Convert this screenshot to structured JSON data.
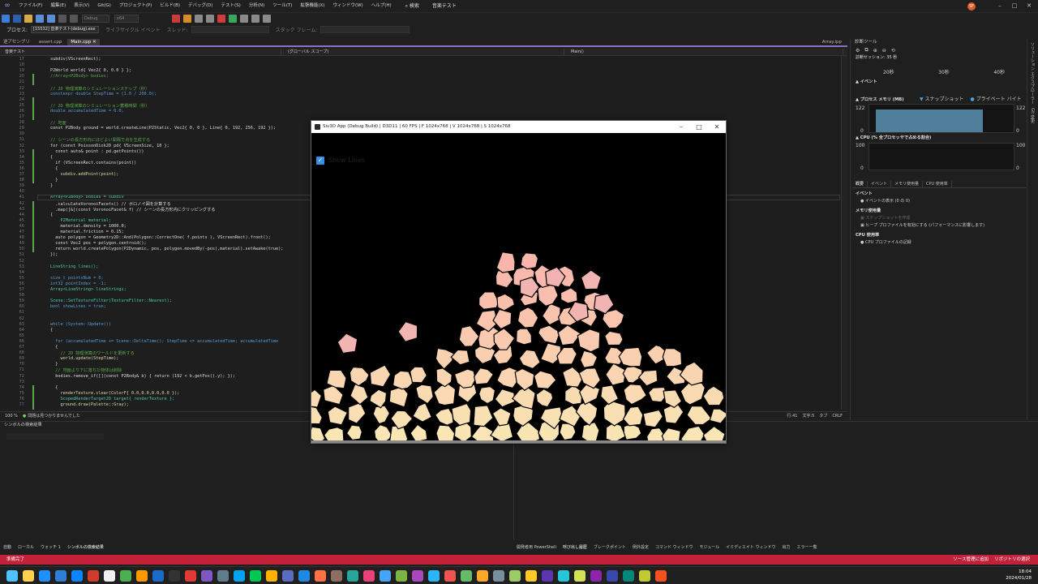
{
  "menubar": {
    "items": [
      "ファイル(F)",
      "編集(E)",
      "表示(V)",
      "Git(G)",
      "プロジェクト(P)",
      "ビルド(B)",
      "デバッグ(D)",
      "テスト(S)",
      "分析(N)",
      "ツール(T)",
      "拡張機能(X)",
      "ウィンドウ(W)",
      "ヘルプ(H)"
    ],
    "search_label": "検索",
    "solution_title": "音楽テスト",
    "avatar_initials": "SF"
  },
  "toolbar": {
    "config": "Debug",
    "platform": "x64",
    "process_label": "プロセス:",
    "process_value": "[15532] 音楽テスト(debug).exe",
    "lifecycle_label": "ライフサイクル イベント",
    "thread_label": "スレッド:",
    "stack_label": "スタック フレーム:"
  },
  "tabs": [
    "逆アセンブリ",
    "assert.cpp",
    "Main.cpp"
  ],
  "tab_right": "Array.ipp",
  "navbar": {
    "project": "音楽テスト",
    "scope": "(グローバル スコープ)",
    "member": "Main()"
  },
  "editor": {
    "lines": [
      {
        "n": "17",
        "t": "subdiv(VScreenRect);",
        "c": "tx"
      },
      {
        "n": "18",
        "t": "",
        "c": "tx"
      },
      {
        "n": "19",
        "t": "P2World world{ Vec2{ 0, 0.0 } };",
        "c": "tx"
      },
      {
        "n": "20",
        "t": "//Array<P2Body> bodies;",
        "c": "com"
      },
      {
        "n": "21",
        "t": "",
        "c": "tx"
      },
      {
        "n": "22",
        "t": "// 2D 物理演算のシミュレーションステップ（秒）",
        "c": "com"
      },
      {
        "n": "23",
        "t": "constexpr double StepTime = (1.0 / 200.0);",
        "c": "kw"
      },
      {
        "n": "24",
        "t": "",
        "c": "tx"
      },
      {
        "n": "25",
        "t": "// 2D 物理演算のシミュレーション蓄積時間（秒）",
        "c": "com"
      },
      {
        "n": "26",
        "t": "double accumulatedTime = 0.0;",
        "c": "kw"
      },
      {
        "n": "27",
        "t": "",
        "c": "tx"
      },
      {
        "n": "28",
        "t": "// 地面",
        "c": "com"
      },
      {
        "n": "29",
        "t": "const P2Body ground = world.createLine(P2Static, Vec2{ 0, 0 }, Line{ 0, 192, 256, 192 });",
        "c": "tx"
      },
      {
        "n": "30",
        "t": "",
        "c": "tx"
      },
      {
        "n": "31",
        "t": "// シーンの長方形内にほどよい間隔で点を生成する",
        "c": "com"
      },
      {
        "n": "32",
        "t": "for (const PoissonDisk2D pd{ VScreenSize, 10 };",
        "c": "tx"
      },
      {
        "n": "33",
        "t": "  const auto& point : pd.getPoints())",
        "c": "tx"
      },
      {
        "n": "34",
        "t": "{",
        "c": "tx"
      },
      {
        "n": "35",
        "t": "  if (VScreenRect.contains(point))",
        "c": "tx"
      },
      {
        "n": "36",
        "t": "  {",
        "c": "tx"
      },
      {
        "n": "37",
        "t": "    subdiv.addPoint(point);",
        "c": "fn"
      },
      {
        "n": "38",
        "t": "  }",
        "c": "tx"
      },
      {
        "n": "39",
        "t": "}",
        "c": "tx"
      },
      {
        "n": "40",
        "t": "",
        "c": "tx"
      },
      {
        "n": "41",
        "t": "Array<P2Body> bodies = subdiv",
        "c": "ty"
      },
      {
        "n": "42",
        "t": "  .calculateVoronoiFacets() // ボロノイ図を計算する",
        "c": "tx"
      },
      {
        "n": "43",
        "t": "  .map([&](const VoronoiFacet& f) // シーンの長方形内にクリッピングする",
        "c": "tx"
      },
      {
        "n": "44",
        "t": "{",
        "c": "tx"
      },
      {
        "n": "45",
        "t": "    P2Material material;",
        "c": "ty"
      },
      {
        "n": "46",
        "t": "    material.density = 1000.0;",
        "c": "tx"
      },
      {
        "n": "47",
        "t": "    material.friction = 0.15;",
        "c": "tx"
      },
      {
        "n": "48",
        "t": "  auto polygon = Geometry2D::And(Polygon::CorrectOne( f.points ), VScreenRect).front();",
        "c": "tx"
      },
      {
        "n": "49",
        "t": "  const Vec2 pos = polygon.centroid();",
        "c": "tx"
      },
      {
        "n": "50",
        "t": "  return world.createPolygon(P2Dynamic, pos, polygon.movedBy(-pos),material).setAwake(true);",
        "c": "tx"
      },
      {
        "n": "51",
        "t": "});",
        "c": "tx"
      },
      {
        "n": "52",
        "t": "",
        "c": "tx"
      },
      {
        "n": "53",
        "t": "LineString lines();",
        "c": "ty"
      },
      {
        "n": "54",
        "t": "",
        "c": "tx"
      },
      {
        "n": "55",
        "t": "size_t pointsNum = 0;",
        "c": "kw"
      },
      {
        "n": "56",
        "t": "int32 pointIndex = -1;",
        "c": "kw"
      },
      {
        "n": "57",
        "t": "Array<LineString> lineStrings;",
        "c": "ty"
      },
      {
        "n": "58",
        "t": "",
        "c": "tx"
      },
      {
        "n": "59",
        "t": "Scene::SetTextureFilter(TextureFilter::Nearest);",
        "c": "ty"
      },
      {
        "n": "60",
        "t": "bool showLines = true;",
        "c": "kw"
      },
      {
        "n": "61",
        "t": "",
        "c": "tx"
      },
      {
        "n": "62",
        "t": "",
        "c": "tx"
      },
      {
        "n": "63",
        "t": "while (System::Update())",
        "c": "kw"
      },
      {
        "n": "64",
        "t": "{",
        "c": "tx"
      },
      {
        "n": "65",
        "t": "",
        "c": "tx"
      },
      {
        "n": "66",
        "t": "  for (accumulatedTime += Scene::DeltaTime(); StepTime <= accumulatedTime; accumulatedTime",
        "c": "kw"
      },
      {
        "n": "67",
        "t": "  {",
        "c": "tx"
      },
      {
        "n": "68",
        "t": "    // 2D 物理演算のワールドを更新する",
        "c": "com"
      },
      {
        "n": "69",
        "t": "    world.update(StepTime);",
        "c": "fn"
      },
      {
        "n": "70",
        "t": "  }",
        "c": "tx"
      },
      {
        "n": "71",
        "t": "  // 地面より下に落ちた物体は削除",
        "c": "com"
      },
      {
        "n": "72",
        "t": "  bodies.remove_if([](const P2Body& b) { return (192 < b.getPos().y); });",
        "c": "tx"
      },
      {
        "n": "73",
        "t": "",
        "c": "tx"
      },
      {
        "n": "74",
        "t": "  {",
        "c": "tx"
      },
      {
        "n": "75",
        "t": "    renderTexture.clear(ColorF{ 0.0,0.0,0.0,0.0 });",
        "c": "fn"
      },
      {
        "n": "76",
        "t": "    ScopedRenderTarget2D target{ renderTexture };",
        "c": "ty"
      },
      {
        "n": "77",
        "t": "    ground.draw(Palette::Gray);",
        "c": "fn"
      }
    ]
  },
  "editor_status": {
    "zoom": "100 %",
    "issues": "問題は見つかりませんでした",
    "line": "行:41",
    "col": "文字:5",
    "tab": "タブ",
    "eol": "CRLF"
  },
  "right_panel": {
    "title": "診断ツール",
    "session": "診断セッション: 35 秒",
    "ticks": [
      "20秒",
      "30秒",
      "40秒"
    ],
    "events_label": "イベント",
    "mem_label": "プロセス メモリ (MB)",
    "snapshot": "スナップショット",
    "private_bytes": "プライベート バイト",
    "mem_max": "122",
    "mem_min": "0",
    "cpu_label": "CPU (% 全プロセッサで占める割合)",
    "cpu_max": "100",
    "cpu_min": "0",
    "tabs": [
      "概要",
      "イベント",
      "メモリ使用量",
      "CPU 使用率"
    ],
    "sec_events": "イベント",
    "events_show": "イベントの表示 (0 の 0)",
    "sec_mem": "メモリ使用量",
    "snapshot_take": "スナップショットを作成",
    "heap_profile": "ヒープ プロファイルを有効にする (パフォーマンスに影響します)",
    "sec_cpu": "CPU 使用率",
    "cpu_record": "CPU プロファイルの記録",
    "strip": [
      "ソリューション エクスプローラー",
      "Git 変更"
    ]
  },
  "bottom": {
    "left_title": "シンボルの検索結果",
    "left_tabs": [
      "自動",
      "ローカル",
      "ウォッチ 1",
      "シンボルの検索結果"
    ],
    "right_tabs": [
      "開発者用 PowerShell",
      "呼び出し履歴",
      "ブレークポイント",
      "例外設定",
      "コマンド ウィンドウ",
      "モジュール",
      "イミディエイト ウィンドウ",
      "出力",
      "エラー一覧"
    ]
  },
  "statusbar": {
    "left": "準備完了",
    "right1": "ソース管理に追加",
    "right2": "リポジトリの選択"
  },
  "taskbar": {
    "time": "18:04",
    "date": "2024/01/28",
    "colors": [
      "#ffd24d",
      "#1e90ff",
      "#2e7dd7",
      "#0a84ff",
      "#d13b2b",
      "#f0f0f0",
      "#4caf50",
      "#ff9800",
      "#1b6ac9",
      "#333",
      "#e53935",
      "#7e57c2",
      "#607d8b",
      "#00a4ef",
      "#00c853",
      "#ffb300",
      "#5c6bc0",
      "#1e88e5",
      "#ff7043",
      "#8d6e63",
      "#26a69a",
      "#ec407a",
      "#42a5f5",
      "#7cb342",
      "#ab47bc",
      "#29b6f6",
      "#ef5350",
      "#66bb6a",
      "#ffa726",
      "#78909c",
      "#9ccc65",
      "#ffca28",
      "#5e35b1",
      "#26c6da",
      "#d4e157",
      "#8e24aa",
      "#3949ab",
      "#00897b",
      "#c0ca33",
      "#f4511e"
    ]
  },
  "app_window": {
    "title": "Siv3D App (Debug Build) | D3D11 | 60 FPS | F 1024x768 | V 1024x768 | S 1024x768",
    "checkbox_label": "Show Lines",
    "checkbox_checked": true
  }
}
